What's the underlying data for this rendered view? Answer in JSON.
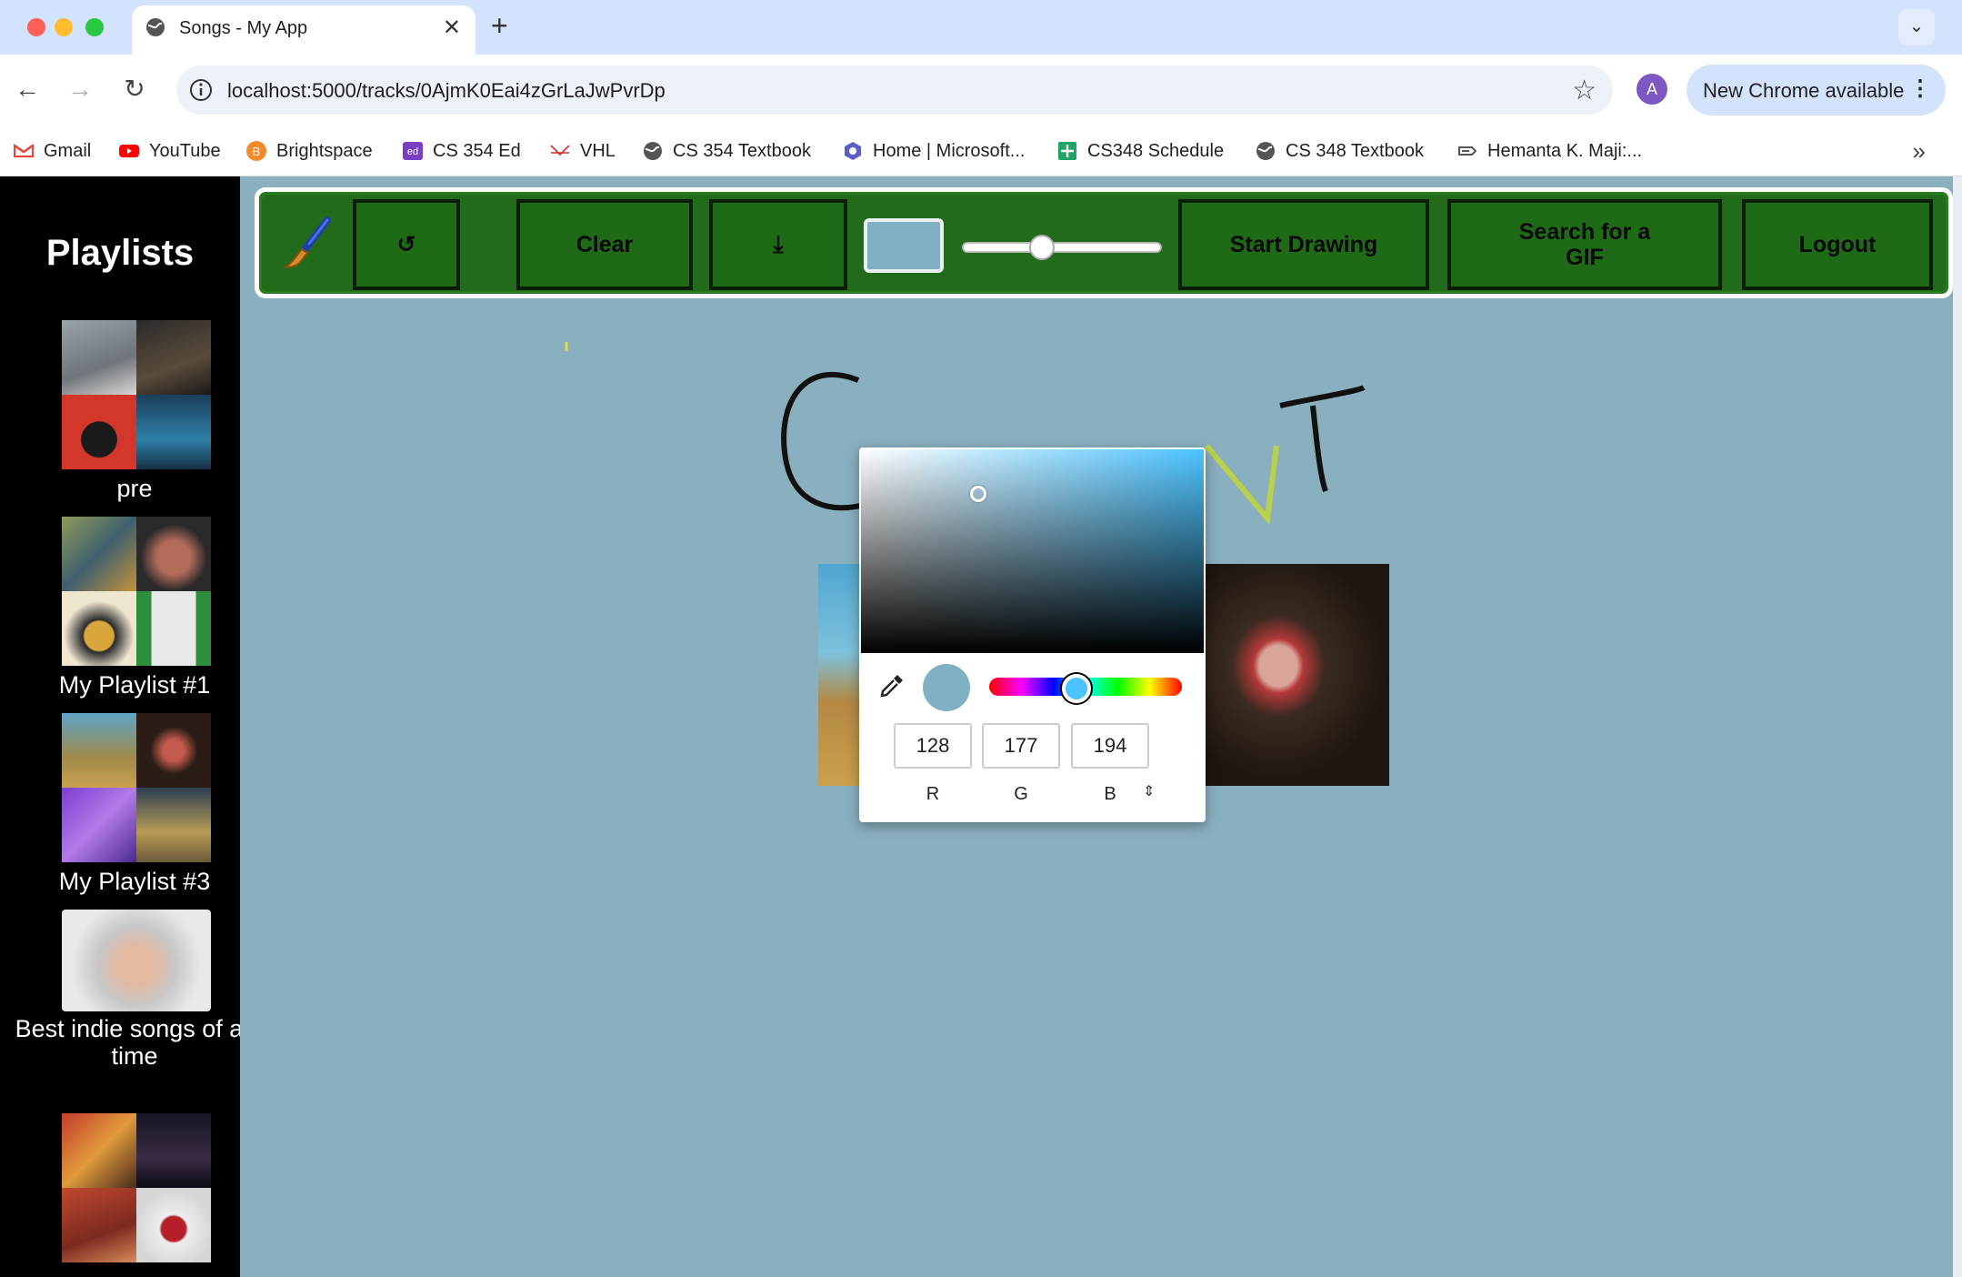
{
  "browser": {
    "tab_title": "Songs - My App",
    "tab_close": "✕",
    "new_tab": "+",
    "tab_menu": "⌄",
    "url": "localhost:5000/tracks/0AjmK0Eai4zGrLaJwPvrDp",
    "profile_initial": "A",
    "update_label": "New Chrome available",
    "menu_dots": "⋮",
    "bookmarks": [
      {
        "label": "Gmail",
        "icon": "gmail-icon",
        "color": "#ea4335"
      },
      {
        "label": "YouTube",
        "icon": "youtube-icon",
        "color": "#ff0000"
      },
      {
        "label": "Brightspace",
        "icon": "brightspace-icon",
        "color": "#f38b2a"
      },
      {
        "label": "CS 354 Ed",
        "icon": "ed-icon",
        "color": "#7b3fc4"
      },
      {
        "label": "VHL",
        "icon": "vhl-icon",
        "color": "#d32f2f"
      },
      {
        "label": "CS 354 Textbook",
        "icon": "globe-icon",
        "color": "#555555"
      },
      {
        "label": "Home | Microsoft...",
        "icon": "microsoft-icon",
        "color": "#5b5fc7"
      },
      {
        "label": "CS348 Schedule",
        "icon": "sheets-icon",
        "color": "#1fa463"
      },
      {
        "label": "CS 348 Textbook",
        "icon": "globe-icon",
        "color": "#555555"
      },
      {
        "label": "Hemanta K. Maji:...",
        "icon": "bookmark-icon",
        "color": "#555555"
      }
    ],
    "bookmarks_more": "»"
  },
  "sidebar": {
    "title": "Playlists",
    "playlists": [
      {
        "name": "pre"
      },
      {
        "name": "My Playlist #1"
      },
      {
        "name": "My Playlist #3"
      },
      {
        "name": "Best indie songs of all time"
      }
    ]
  },
  "toolbar": {
    "undo_label": "↺",
    "clear_label": "Clear",
    "download_label": "⤓",
    "start_drawing_label": "Start Drawing",
    "search_gif_label": "Search for a GIF",
    "logout_label": "Logout",
    "current_color": "#80b1c2",
    "brush_size_fraction": 0.4
  },
  "color_picker": {
    "r_label": "R",
    "g_label": "G",
    "b_label": "B",
    "r_value": "128",
    "g_value": "177",
    "b_value": "194",
    "mode_toggle": "⇕"
  }
}
